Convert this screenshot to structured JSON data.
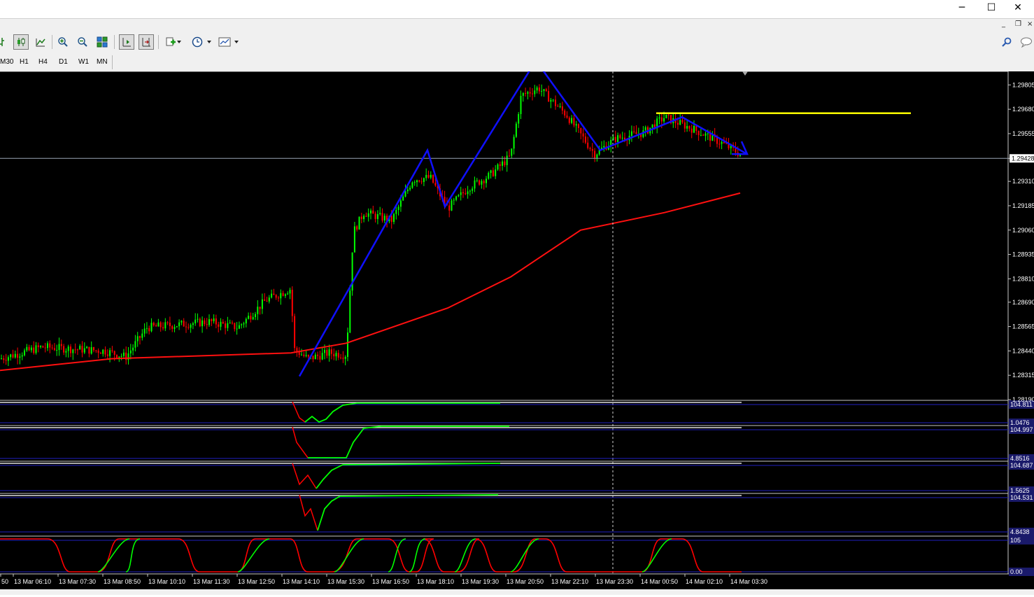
{
  "window": {
    "minimize": "─",
    "maximize": "☐",
    "close": "✕",
    "mdi_minimize": "_",
    "mdi_restore": "❐",
    "mdi_close": "×"
  },
  "toolbar": {
    "icons": [
      "bar-chart-icon",
      "candlestick-icon",
      "line-chart-icon",
      "zoom-in-icon",
      "zoom-out-icon",
      "tile-windows-icon",
      "chart-shift-icon",
      "autoscroll-icon",
      "indicators-icon",
      "periods-icon",
      "templates-icon"
    ],
    "timeframes": [
      "M30",
      "H1",
      "H4",
      "D1",
      "W1",
      "MN"
    ]
  },
  "price_axis": {
    "labels": [
      "1.29805",
      "1.29680",
      "1.29555",
      "1.29428",
      "1.29310",
      "1.29185",
      "1.29060",
      "1.28935",
      "1.28810",
      "1.28690",
      "1.28565",
      "1.28440",
      "1.28315",
      "1.28190"
    ],
    "current_price": "1.29428"
  },
  "indicators": [
    {
      "top": "104.811",
      "bottom": "1.0476"
    },
    {
      "top": "104.997",
      "bottom": "4.8516"
    },
    {
      "top": "104.687",
      "bottom": "1.5625"
    },
    {
      "top": "104.531",
      "bottom": "4.8438"
    },
    {
      "top": "105",
      "bottom": "0.00"
    }
  ],
  "time_axis": [
    "50",
    "13 Mar 06:10",
    "13 Mar 07:30",
    "13 Mar 08:50",
    "13 Mar 10:10",
    "13 Mar 11:30",
    "13 Mar 12:50",
    "13 Mar 14:10",
    "13 Mar 15:30",
    "13 Mar 16:50",
    "13 Mar 18:10",
    "13 Mar 19:30",
    "13 Mar 20:50",
    "13 Mar 22:10",
    "13 Mar 23:30",
    "14 Mar 00:50",
    "14 Mar 02:10",
    "14 Mar 03:30"
  ],
  "colors": {
    "background": "#000000",
    "bull": "#00ff00",
    "bear": "#ff0000",
    "ma": "#ff1010",
    "zigzag": "#1010ff",
    "resistance": "#ffff00",
    "levels": "#2020c0"
  },
  "chart_data": {
    "type": "candlestick",
    "y_range": [
      1.2819,
      1.2986
    ],
    "current_price": 1.29428,
    "resistance_level": 1.2966,
    "zigzag_prices": [
      1.2831,
      1.2947,
      1.2918,
      1.2993,
      1.2947,
      1.2964,
      1.2945
    ],
    "moving_average_prices": [
      1.2834,
      1.284,
      1.2843,
      1.2848,
      1.2866,
      1.2882,
      1.2906,
      1.2915,
      1.2925
    ],
    "indicator_panels": 5
  }
}
